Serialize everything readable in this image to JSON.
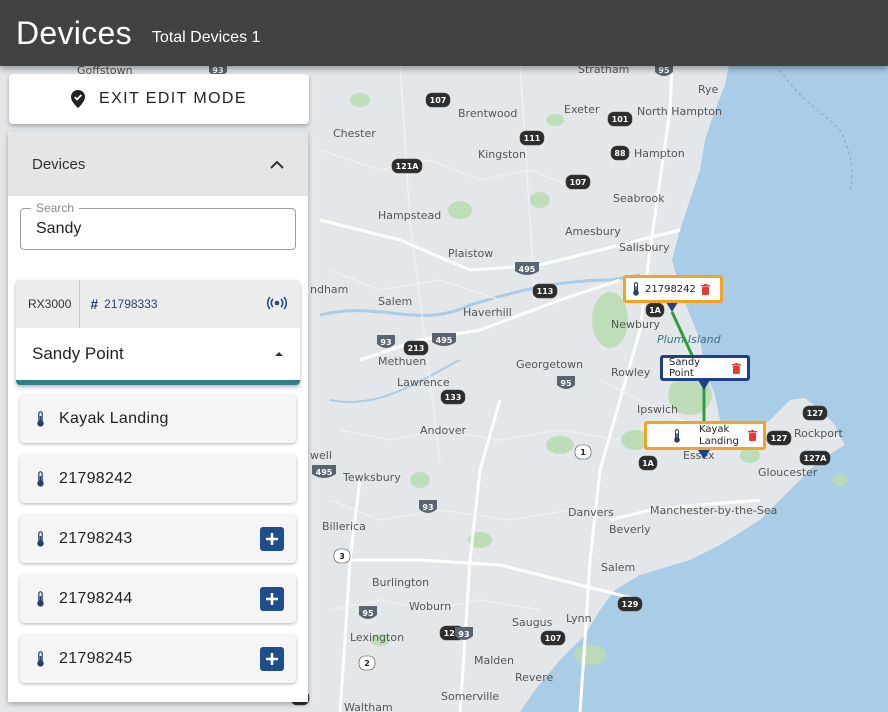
{
  "header": {
    "title": "Devices",
    "total_label": "Total Devices 1"
  },
  "edit_button": {
    "label": "EXIT EDIT MODE",
    "icon": "map-pin-check-icon"
  },
  "panel": {
    "title": "Devices",
    "search": {
      "legend": "Search",
      "value": "Sandy"
    },
    "device": {
      "model": "RX3000",
      "serial": "21798333",
      "name": "Sandy Point",
      "signal_icon": "radio-signal-icon"
    },
    "sensors": [
      {
        "label": "Kayak Landing",
        "addable": false
      },
      {
        "label": "21798242",
        "addable": false
      },
      {
        "label": "21798243",
        "addable": true
      },
      {
        "label": "21798244",
        "addable": true
      },
      {
        "label": "21798245",
        "addable": true
      }
    ]
  },
  "map_markers": {
    "sensor_a": "21798242",
    "gateway": "Sandy Point",
    "sensor_b": "Kayak Landing"
  },
  "map": {
    "towns": [
      "Goffstown",
      "Stratham",
      "Rye",
      "North Hampton",
      "Brentwood",
      "Exeter",
      "Hampton",
      "Chester",
      "Kingston",
      "Seabrook",
      "Hampstead",
      "Amesbury",
      "Salisbury",
      "Plaistow",
      "Newbury",
      "ndham",
      "Salem",
      "Haverhill",
      "Methuen",
      "Georgetown",
      "Rowley",
      "Lawrence",
      "Ipswich",
      "Andover",
      "Essex",
      "Rockport",
      "well",
      "Tewksbury",
      "Gloucester",
      "Danvers",
      "Manchester-by-the-Sea",
      "Beverly",
      "Billerica",
      "Salem",
      "Burlington",
      "Woburn",
      "Lynn",
      "Saugus",
      "Lexington",
      "Malden",
      "Revere",
      "Somerville",
      "Waltham"
    ],
    "water_labels": [
      "Plum Island"
    ],
    "shields": [
      "93",
      "107",
      "101",
      "95",
      "111",
      "121A",
      "88",
      "107",
      "495",
      "113",
      "93",
      "213",
      "495",
      "95",
      "133",
      "127",
      "1A",
      "127",
      "127A",
      "1A",
      "1",
      "495",
      "93",
      "3",
      "95",
      "128",
      "93",
      "107",
      "129",
      "2",
      "1A"
    ]
  },
  "colors": {
    "header": "#424242",
    "accent_orange": "#f4a320",
    "accent_blue": "#20408a",
    "teal_bar": "#2f7f88",
    "add_button": "#1f4e8c",
    "link_line": "#2e9e3a",
    "trash": "#e53935"
  }
}
